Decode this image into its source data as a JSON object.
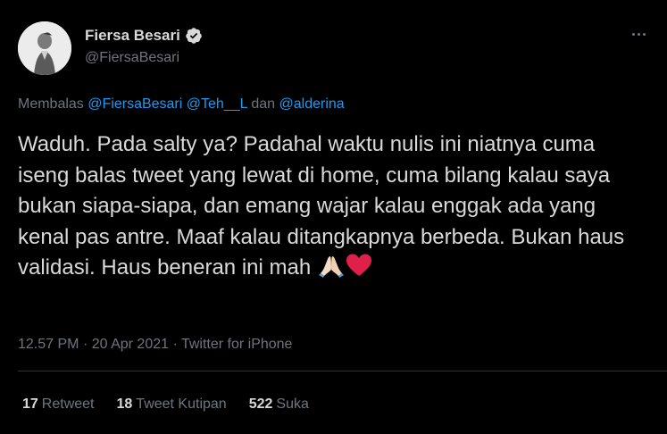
{
  "author": {
    "name": "Fiersa Besari",
    "handle": "@FiersaBesari",
    "verified": true
  },
  "reply_to": {
    "prefix": "Membalas",
    "mention1": "@FiersaBesari",
    "mention2": "@Teh__L",
    "joiner": "dan",
    "mention3": "@alderina"
  },
  "tweet": {
    "text": "Waduh. Pada salty ya? Padahal waktu nulis ini niatnya cuma iseng balas tweet yang lewat di home, cuma bilang kalau saya bukan siapa-siapa, dan emang wajar kalau enggak ada yang kenal pas antre. Maaf kalau ditangkapnya berbeda. Bukan haus validasi. Haus beneran ini mah",
    "emojis": [
      "folded-hands",
      "red-heart"
    ]
  },
  "meta": {
    "time": "12.57 PM",
    "date": "20 Apr 2021",
    "separator": "·",
    "source": "Twitter for iPhone"
  },
  "stats": {
    "retweets_count": "17",
    "retweets_label": "Retweet",
    "quotes_count": "18",
    "quotes_label": "Tweet Kutipan",
    "likes_count": "522",
    "likes_label": "Suka"
  },
  "colors": {
    "background": "#000000",
    "text": "#d9d9d9",
    "muted": "#6e767d",
    "accent": "#1d9bf0",
    "divider": "#2f3336"
  }
}
